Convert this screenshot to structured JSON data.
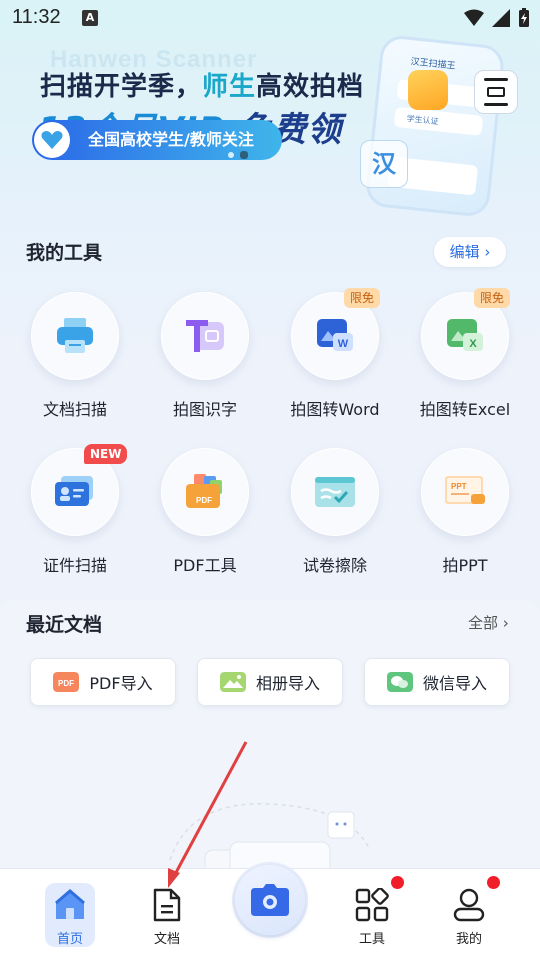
{
  "status_bar": {
    "time": "11:32",
    "notification_letter": "A"
  },
  "banner": {
    "watermark": "Hanwen Scanner",
    "line1_a": "扫描开学季，",
    "line1_b": "师生",
    "line1_c": "高效拍档",
    "line2_a": "13个月VIP",
    "line2_b": "免费领",
    "pill_text": "全国高校学生/教师关注",
    "phone_title": "汉王扫描王",
    "phone_row_label": "学生认证",
    "han_char": "汉"
  },
  "tools_section": {
    "title": "我的工具",
    "edit_label": "编辑",
    "items": [
      {
        "label": "文档扫描",
        "icon": "printer-icon",
        "badge": ""
      },
      {
        "label": "拍图识字",
        "icon": "text-recognize-icon",
        "badge": ""
      },
      {
        "label": "拍图转Word",
        "icon": "word-icon",
        "badge": "限免"
      },
      {
        "label": "拍图转Excel",
        "icon": "excel-icon",
        "badge": "限免"
      },
      {
        "label": "证件扫描",
        "icon": "id-card-icon",
        "badge": "NEW"
      },
      {
        "label": "PDF工具",
        "icon": "pdf-tools-icon",
        "badge": ""
      },
      {
        "label": "试卷擦除",
        "icon": "exam-erase-icon",
        "badge": ""
      },
      {
        "label": "拍PPT",
        "icon": "ppt-icon",
        "badge": ""
      }
    ]
  },
  "recent_section": {
    "title": "最近文档",
    "all_label": "全部",
    "import_buttons": [
      {
        "label": "PDF导入",
        "icon": "pdf-import-icon",
        "color": "#f27a54"
      },
      {
        "label": "相册导入",
        "icon": "album-import-icon",
        "color": "#9bd06a"
      },
      {
        "label": "微信导入",
        "icon": "wechat-import-icon",
        "color": "#63c785"
      }
    ]
  },
  "bottom_nav": {
    "items": [
      {
        "label": "首页",
        "icon": "home-icon",
        "active": true
      },
      {
        "label": "文档",
        "icon": "document-icon",
        "active": false
      },
      {
        "label": "工具",
        "icon": "tools-grid-icon",
        "active": false,
        "dot": true
      },
      {
        "label": "我的",
        "icon": "profile-icon",
        "active": false,
        "dot": true
      }
    ]
  },
  "colors": {
    "accent": "#2b6fe0",
    "badge_limited_bg": "#ffd9a8",
    "badge_new_bg": "#f24b4b",
    "notification_dot": "#f21d2a",
    "annotation_arrow": "#e04040"
  }
}
